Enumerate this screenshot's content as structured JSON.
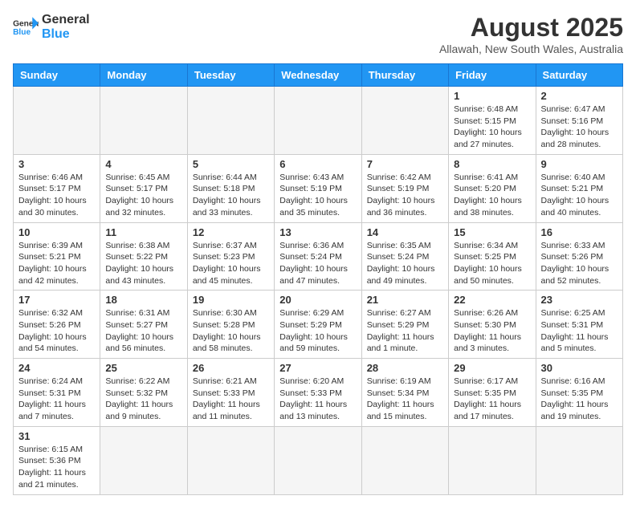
{
  "header": {
    "logo_general": "General",
    "logo_blue": "Blue",
    "month_title": "August 2025",
    "location": "Allawah, New South Wales, Australia"
  },
  "weekdays": [
    "Sunday",
    "Monday",
    "Tuesday",
    "Wednesday",
    "Thursday",
    "Friday",
    "Saturday"
  ],
  "weeks": [
    [
      {
        "day": "",
        "info": ""
      },
      {
        "day": "",
        "info": ""
      },
      {
        "day": "",
        "info": ""
      },
      {
        "day": "",
        "info": ""
      },
      {
        "day": "",
        "info": ""
      },
      {
        "day": "1",
        "info": "Sunrise: 6:48 AM\nSunset: 5:15 PM\nDaylight: 10 hours and 27 minutes."
      },
      {
        "day": "2",
        "info": "Sunrise: 6:47 AM\nSunset: 5:16 PM\nDaylight: 10 hours and 28 minutes."
      }
    ],
    [
      {
        "day": "3",
        "info": "Sunrise: 6:46 AM\nSunset: 5:17 PM\nDaylight: 10 hours and 30 minutes."
      },
      {
        "day": "4",
        "info": "Sunrise: 6:45 AM\nSunset: 5:17 PM\nDaylight: 10 hours and 32 minutes."
      },
      {
        "day": "5",
        "info": "Sunrise: 6:44 AM\nSunset: 5:18 PM\nDaylight: 10 hours and 33 minutes."
      },
      {
        "day": "6",
        "info": "Sunrise: 6:43 AM\nSunset: 5:19 PM\nDaylight: 10 hours and 35 minutes."
      },
      {
        "day": "7",
        "info": "Sunrise: 6:42 AM\nSunset: 5:19 PM\nDaylight: 10 hours and 36 minutes."
      },
      {
        "day": "8",
        "info": "Sunrise: 6:41 AM\nSunset: 5:20 PM\nDaylight: 10 hours and 38 minutes."
      },
      {
        "day": "9",
        "info": "Sunrise: 6:40 AM\nSunset: 5:21 PM\nDaylight: 10 hours and 40 minutes."
      }
    ],
    [
      {
        "day": "10",
        "info": "Sunrise: 6:39 AM\nSunset: 5:21 PM\nDaylight: 10 hours and 42 minutes."
      },
      {
        "day": "11",
        "info": "Sunrise: 6:38 AM\nSunset: 5:22 PM\nDaylight: 10 hours and 43 minutes."
      },
      {
        "day": "12",
        "info": "Sunrise: 6:37 AM\nSunset: 5:23 PM\nDaylight: 10 hours and 45 minutes."
      },
      {
        "day": "13",
        "info": "Sunrise: 6:36 AM\nSunset: 5:24 PM\nDaylight: 10 hours and 47 minutes."
      },
      {
        "day": "14",
        "info": "Sunrise: 6:35 AM\nSunset: 5:24 PM\nDaylight: 10 hours and 49 minutes."
      },
      {
        "day": "15",
        "info": "Sunrise: 6:34 AM\nSunset: 5:25 PM\nDaylight: 10 hours and 50 minutes."
      },
      {
        "day": "16",
        "info": "Sunrise: 6:33 AM\nSunset: 5:26 PM\nDaylight: 10 hours and 52 minutes."
      }
    ],
    [
      {
        "day": "17",
        "info": "Sunrise: 6:32 AM\nSunset: 5:26 PM\nDaylight: 10 hours and 54 minutes."
      },
      {
        "day": "18",
        "info": "Sunrise: 6:31 AM\nSunset: 5:27 PM\nDaylight: 10 hours and 56 minutes."
      },
      {
        "day": "19",
        "info": "Sunrise: 6:30 AM\nSunset: 5:28 PM\nDaylight: 10 hours and 58 minutes."
      },
      {
        "day": "20",
        "info": "Sunrise: 6:29 AM\nSunset: 5:29 PM\nDaylight: 10 hours and 59 minutes."
      },
      {
        "day": "21",
        "info": "Sunrise: 6:27 AM\nSunset: 5:29 PM\nDaylight: 11 hours and 1 minute."
      },
      {
        "day": "22",
        "info": "Sunrise: 6:26 AM\nSunset: 5:30 PM\nDaylight: 11 hours and 3 minutes."
      },
      {
        "day": "23",
        "info": "Sunrise: 6:25 AM\nSunset: 5:31 PM\nDaylight: 11 hours and 5 minutes."
      }
    ],
    [
      {
        "day": "24",
        "info": "Sunrise: 6:24 AM\nSunset: 5:31 PM\nDaylight: 11 hours and 7 minutes."
      },
      {
        "day": "25",
        "info": "Sunrise: 6:22 AM\nSunset: 5:32 PM\nDaylight: 11 hours and 9 minutes."
      },
      {
        "day": "26",
        "info": "Sunrise: 6:21 AM\nSunset: 5:33 PM\nDaylight: 11 hours and 11 minutes."
      },
      {
        "day": "27",
        "info": "Sunrise: 6:20 AM\nSunset: 5:33 PM\nDaylight: 11 hours and 13 minutes."
      },
      {
        "day": "28",
        "info": "Sunrise: 6:19 AM\nSunset: 5:34 PM\nDaylight: 11 hours and 15 minutes."
      },
      {
        "day": "29",
        "info": "Sunrise: 6:17 AM\nSunset: 5:35 PM\nDaylight: 11 hours and 17 minutes."
      },
      {
        "day": "30",
        "info": "Sunrise: 6:16 AM\nSunset: 5:35 PM\nDaylight: 11 hours and 19 minutes."
      }
    ],
    [
      {
        "day": "31",
        "info": "Sunrise: 6:15 AM\nSunset: 5:36 PM\nDaylight: 11 hours and 21 minutes."
      },
      {
        "day": "",
        "info": ""
      },
      {
        "day": "",
        "info": ""
      },
      {
        "day": "",
        "info": ""
      },
      {
        "day": "",
        "info": ""
      },
      {
        "day": "",
        "info": ""
      },
      {
        "day": "",
        "info": ""
      }
    ]
  ]
}
